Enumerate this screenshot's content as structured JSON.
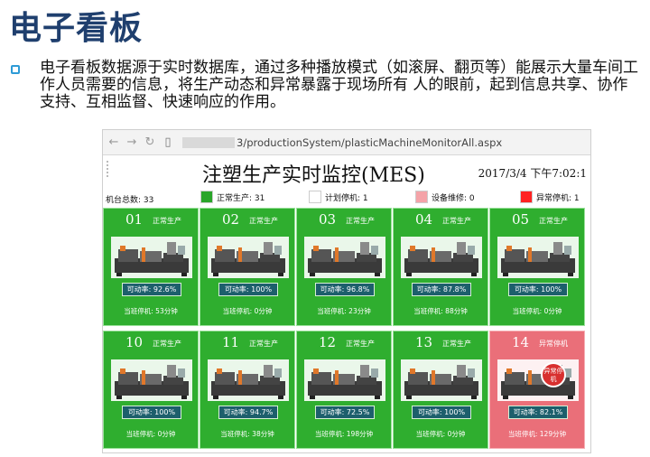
{
  "slide": {
    "title": "电子看板",
    "bullet": "电子看板数据源于实时数据库，通过多种播放模式（如滚屏、翻页等）能展示大量车间工作人员需要的信息，将生产动态和异常暴露于现场所有 人的眼前，起到信息共享、协作支持、互相监督、快速响应的作用。"
  },
  "browser": {
    "url_suffix": "3/productionSystem/plasticMachineMonitorAll.aspx"
  },
  "mes": {
    "title": "注塑生产实时监控(MES)",
    "datetime": "2017/3/4  下午7:02:1",
    "total": "机台总数: 33",
    "legend": [
      {
        "label": "正常生产: 31",
        "color": "#2aa52a"
      },
      {
        "label": "计划停机: 1",
        "color": "#ffffff"
      },
      {
        "label": "设备维修: 0",
        "color": "#f4a3a8"
      },
      {
        "label": "异常停机: 1",
        "color": "#ff2222"
      }
    ]
  },
  "machines": [
    {
      "id": "01",
      "status": "正常生产",
      "rate": "可动率: 92.6%",
      "stop": "当班停机: 53分钟",
      "state": "normal"
    },
    {
      "id": "02",
      "status": "正常生产",
      "rate": "可动率: 100%",
      "stop": "当班停机: 0分钟",
      "state": "normal"
    },
    {
      "id": "03",
      "status": "正常生产",
      "rate": "可动率: 96.8%",
      "stop": "当班停机: 23分钟",
      "state": "normal"
    },
    {
      "id": "04",
      "status": "正常生产",
      "rate": "可动率: 87.8%",
      "stop": "当班停机: 88分钟",
      "state": "normal"
    },
    {
      "id": "05",
      "status": "正常生产",
      "rate": "可动率: 100%",
      "stop": "当班停机: 0分钟",
      "state": "normal"
    },
    {
      "id": "10",
      "status": "正常生产",
      "rate": "可动率: 100%",
      "stop": "当班停机: 0分钟",
      "state": "normal"
    },
    {
      "id": "11",
      "status": "正常生产",
      "rate": "可动率: 94.7%",
      "stop": "当班停机: 38分钟",
      "state": "normal"
    },
    {
      "id": "12",
      "status": "正常生产",
      "rate": "可动率: 72.5%",
      "stop": "当班停机: 198分钟",
      "state": "normal"
    },
    {
      "id": "13",
      "status": "正常生产",
      "rate": "可动率: 100%",
      "stop": "当班停机: 0分钟",
      "state": "normal"
    },
    {
      "id": "14",
      "status": "异常停机",
      "rate": "可动率: 82.1%",
      "stop": "当班停机: 129分钟",
      "state": "stop",
      "alarm": "异常停机"
    }
  ]
}
